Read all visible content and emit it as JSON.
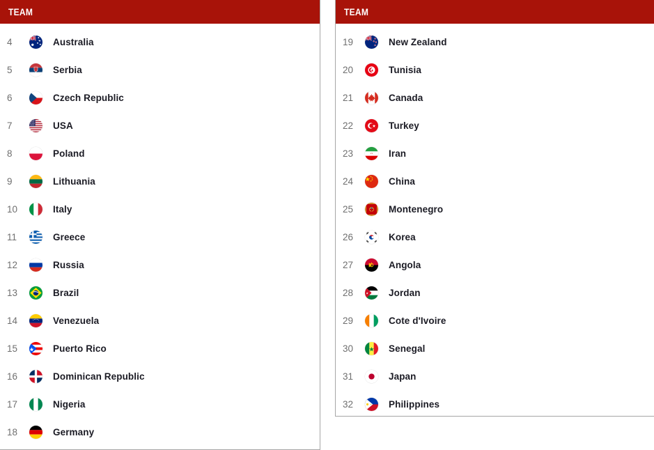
{
  "page": {
    "background_color": "#ffffff",
    "header_color": "#a81309",
    "header_text_color": "#ffffff",
    "rank_text_color": "#6f6f6f",
    "team_text_color": "#1b1b24",
    "panel_border_color": "#a6a6a6"
  },
  "panels": [
    {
      "id": "left",
      "header": {
        "label": "TEAM"
      },
      "rows": [
        {
          "rank": "4",
          "team": "Australia",
          "flag_icon": "flag-australia-icon"
        },
        {
          "rank": "5",
          "team": "Serbia",
          "flag_icon": "flag-serbia-icon"
        },
        {
          "rank": "6",
          "team": "Czech Republic",
          "flag_icon": "flag-czech-republic-icon"
        },
        {
          "rank": "7",
          "team": "USA",
          "flag_icon": "flag-usa-icon"
        },
        {
          "rank": "8",
          "team": "Poland",
          "flag_icon": "flag-poland-icon"
        },
        {
          "rank": "9",
          "team": "Lithuania",
          "flag_icon": "flag-lithuania-icon"
        },
        {
          "rank": "10",
          "team": "Italy",
          "flag_icon": "flag-italy-icon"
        },
        {
          "rank": "11",
          "team": "Greece",
          "flag_icon": "flag-greece-icon"
        },
        {
          "rank": "12",
          "team": "Russia",
          "flag_icon": "flag-russia-icon"
        },
        {
          "rank": "13",
          "team": "Brazil",
          "flag_icon": "flag-brazil-icon"
        },
        {
          "rank": "14",
          "team": "Venezuela",
          "flag_icon": "flag-venezuela-icon"
        },
        {
          "rank": "15",
          "team": "Puerto Rico",
          "flag_icon": "flag-puerto-rico-icon"
        },
        {
          "rank": "16",
          "team": "Dominican Republic",
          "flag_icon": "flag-dominican-republic-icon"
        },
        {
          "rank": "17",
          "team": "Nigeria",
          "flag_icon": "flag-nigeria-icon"
        },
        {
          "rank": "18",
          "team": "Germany",
          "flag_icon": "flag-germany-icon"
        }
      ]
    },
    {
      "id": "right",
      "header": {
        "label": "TEAM"
      },
      "rows": [
        {
          "rank": "19",
          "team": "New Zealand",
          "flag_icon": "flag-new-zealand-icon"
        },
        {
          "rank": "20",
          "team": "Tunisia",
          "flag_icon": "flag-tunisia-icon"
        },
        {
          "rank": "21",
          "team": "Canada",
          "flag_icon": "flag-canada-icon"
        },
        {
          "rank": "22",
          "team": "Turkey",
          "flag_icon": "flag-turkey-icon"
        },
        {
          "rank": "23",
          "team": "Iran",
          "flag_icon": "flag-iran-icon"
        },
        {
          "rank": "24",
          "team": "China",
          "flag_icon": "flag-china-icon"
        },
        {
          "rank": "25",
          "team": "Montenegro",
          "flag_icon": "flag-montenegro-icon"
        },
        {
          "rank": "26",
          "team": "Korea",
          "flag_icon": "flag-korea-icon"
        },
        {
          "rank": "27",
          "team": "Angola",
          "flag_icon": "flag-angola-icon"
        },
        {
          "rank": "28",
          "team": "Jordan",
          "flag_icon": "flag-jordan-icon"
        },
        {
          "rank": "29",
          "team": "Cote d'Ivoire",
          "flag_icon": "flag-cote-divoire-icon"
        },
        {
          "rank": "30",
          "team": "Senegal",
          "flag_icon": "flag-senegal-icon"
        },
        {
          "rank": "31",
          "team": "Japan",
          "flag_icon": "flag-japan-icon"
        },
        {
          "rank": "32",
          "team": "Philippines",
          "flag_icon": "flag-philippines-icon"
        }
      ]
    }
  ]
}
